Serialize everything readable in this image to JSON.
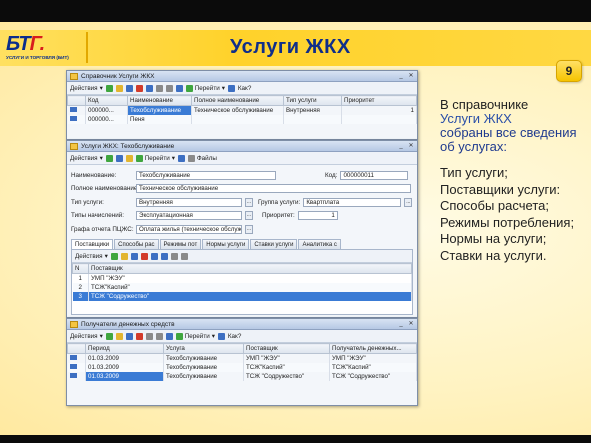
{
  "slide": {
    "title": "Услуги ЖКХ",
    "number": "9",
    "logo_text": "БТ",
    "logo_accent": "Г.",
    "logo_tagline": "УСЛУГИ И ТОРГОВЛЯ (БИТ)"
  },
  "description": {
    "line1": "В справочнике",
    "highlight": "Услуги ЖКХ",
    "rest": "собраны все сведения об услугах:",
    "items": [
      "Тип услуги;",
      "Поставщики услуги:",
      "Способы расчета;",
      "Режимы потребления;",
      "Нормы на услуги;",
      "Ставки на услуги."
    ]
  },
  "win1": {
    "title": "Справочник  Услуги ЖКХ",
    "toolbar": {
      "actions": "Действия",
      "goto": "Перейти",
      "help": "Как?"
    },
    "columns": [
      "Код",
      "Наименование",
      "Полное наименование",
      "Тип услуги",
      "Приоритет"
    ],
    "rows": [
      {
        "code": "000000...",
        "name": "Техобслуживание",
        "full": "Техническое обслуживание",
        "type": "Внутренняя",
        "prio": "1"
      },
      {
        "code": "000000...",
        "name": "Пеня",
        "full": "",
        "type": "",
        "prio": ""
      }
    ]
  },
  "win2": {
    "title": "Услуги ЖКХ: Техобслуживание",
    "toolbar": {
      "actions": "Действия",
      "goto": "Перейти",
      "files": "Файлы"
    },
    "labels": {
      "name": "Наименование:",
      "code": "Код:",
      "full": "Полное наименование:",
      "type": "Тип услуги:",
      "group": "Группа услуги:",
      "charges": "Типы начислений:",
      "prio": "Приоритет:",
      "report": "Графа отчета ПЦЖС:"
    },
    "values": {
      "name": "Техобслуживание",
      "code": "000000011",
      "full": "Техническое обслуживание",
      "type": "Внутренняя",
      "group": "Квартплата",
      "charges": "Эксплуатационная",
      "prio": "1",
      "report": "Оплата жилья (техническое обслуж"
    },
    "tabs": [
      "Поставщики",
      "Способы рас",
      "Режимы пот",
      "Нормы услуги",
      "Ставки услуги",
      "Аналитика с"
    ],
    "toolbar2": {
      "actions": "Действия"
    },
    "columns": [
      "N",
      "Поставщик"
    ],
    "rows": [
      {
        "n": "1",
        "supplier": "УМП \"ЖЭУ\""
      },
      {
        "n": "2",
        "supplier": "ТСЖ\"Каспий\""
      },
      {
        "n": "3",
        "supplier": "ТСЖ \"Содружество\""
      }
    ]
  },
  "win3": {
    "title": "Получатели денежных средств",
    "toolbar": {
      "actions": "Действия",
      "goto": "Перейти",
      "help": "Как?"
    },
    "columns": [
      "Период",
      "Услуга",
      "Поставщик",
      "Получатель денежных..."
    ],
    "rows": [
      {
        "period": "01.03.2009",
        "service": "Техобслуживание",
        "supplier": "УМП \"ЖЭУ\"",
        "recipient": "УМП \"ЖЭУ\""
      },
      {
        "period": "01.03.2009",
        "service": "Техобслуживание",
        "supplier": "ТСЖ\"Каспий\"",
        "recipient": "ТСЖ\"Каспий\""
      },
      {
        "period": "01.03.2009",
        "service": "Техобслуживание",
        "supplier": "ТСЖ \"Содружество\"",
        "recipient": "ТСЖ \"Содружество\""
      }
    ]
  },
  "colors": {
    "title": "#0f2e8a",
    "header_band": "#ffd22a",
    "selection": "#3a7bd5",
    "text_blue": "#2a4fa8"
  }
}
